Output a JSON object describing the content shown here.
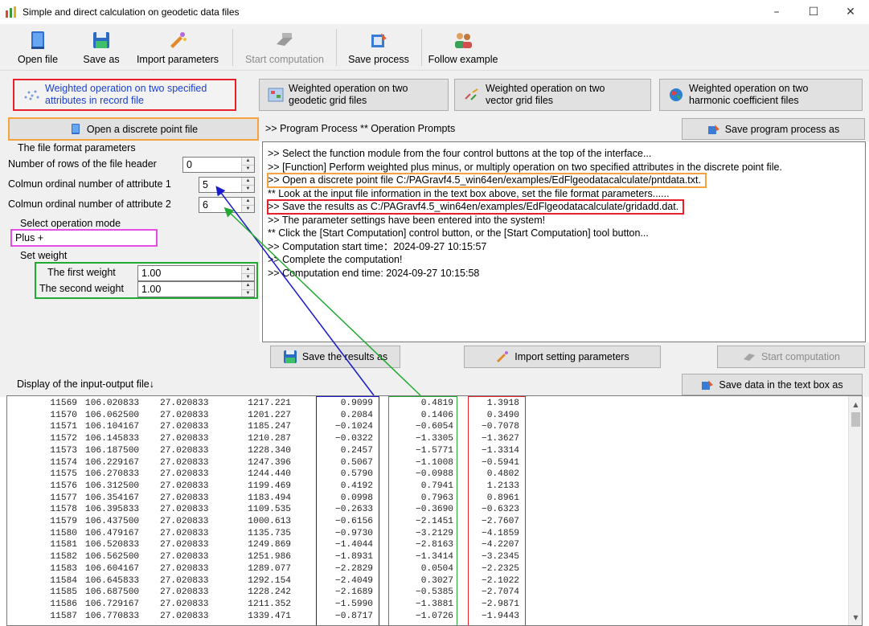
{
  "window": {
    "title": "Simple and direct calculation on geodetic data files",
    "minimize": "–",
    "maximize": "☐",
    "close": "✕"
  },
  "toolbar": {
    "open_file": "Open file",
    "save_as": "Save as",
    "import_parameters": "Import parameters",
    "start_computation": "Start computation",
    "save_process": "Save process",
    "follow_example": "Follow example"
  },
  "modules": {
    "m1_line1": "Weighted operation on two specified",
    "m1_line2": "attributes in record file",
    "m2_line1": "Weighted operation on two",
    "m2_line2": "geodetic grid files",
    "m3_line1": "Weighted operation on two",
    "m3_line2": "vector grid files",
    "m4_line1": "Weighted operation on two",
    "m4_line2": "harmonic coefficient files"
  },
  "left": {
    "open_point_file": "Open a discrete point file",
    "format_params_label": "The file format parameters",
    "header_rows_label": "Number of rows of the file header",
    "header_rows_value": "0",
    "attr1_label": "Colmun ordinal number of attribute 1",
    "attr1_value": "5",
    "attr2_label": "Colmun ordinal number of attribute 2",
    "attr2_value": "6",
    "op_mode_label": "Select operation mode",
    "op_mode_value": "Plus +",
    "set_weight_label": "Set weight",
    "first_weight_label": "The first weight",
    "first_weight_value": "1.00",
    "second_weight_label": "The second weight",
    "second_weight_value": "1.00"
  },
  "process": {
    "header": ">> Program Process  ** Operation Prompts",
    "save_process_btn": "Save program process as",
    "lines": [
      ">> Select the function module from the four control buttons at the top of the interface...",
      ">> [Function] Perform weighted plus minus, or multiply operation on two specified attributes in the discrete point file.",
      ">> Open a discrete point file C:/PAGravf4.5_win64en/examples/EdFlgeodatacalculate/pntdata.txt.",
      "  ** Look at the input file information in the text box above, set the file format parameters......",
      ">> Save the results as C:/PAGravf4.5_win64en/examples/EdFlgeodatacalculate/gridadd.dat.",
      ">> The parameter settings have been entered into the system!",
      "  ** Click the [Start Computation] control button, or the [Start Computation] tool button...",
      ">> Computation start time：2024-09-27 10:15:57",
      ">> Complete the computation!",
      ">> Computation end time: 2024-09-27 10:15:58"
    ]
  },
  "actions": {
    "save_results": "Save the results as",
    "import_settings": "Import setting parameters",
    "start_computation": "Start computation"
  },
  "display": {
    "label": "Display of the input-output file↓",
    "save_text_btn": "Save data in the text box as"
  },
  "data_rows": [
    [
      "11569",
      "106.020833",
      "27.020833",
      "1217.221",
      "0.9099",
      "0.4819",
      "1.3918"
    ],
    [
      "11570",
      "106.062500",
      "27.020833",
      "1201.227",
      "0.2084",
      "0.1406",
      "0.3490"
    ],
    [
      "11571",
      "106.104167",
      "27.020833",
      "1185.247",
      "−0.1024",
      "−0.6054",
      "−0.7078"
    ],
    [
      "11572",
      "106.145833",
      "27.020833",
      "1210.287",
      "−0.0322",
      "−1.3305",
      "−1.3627"
    ],
    [
      "11573",
      "106.187500",
      "27.020833",
      "1228.340",
      "0.2457",
      "−1.5771",
      "−1.3314"
    ],
    [
      "11574",
      "106.229167",
      "27.020833",
      "1247.396",
      "0.5067",
      "−1.1008",
      "−0.5941"
    ],
    [
      "11575",
      "106.270833",
      "27.020833",
      "1244.440",
      "0.5790",
      "−0.0988",
      "0.4802"
    ],
    [
      "11576",
      "106.312500",
      "27.020833",
      "1199.469",
      "0.4192",
      "0.7941",
      "1.2133"
    ],
    [
      "11577",
      "106.354167",
      "27.020833",
      "1183.494",
      "0.0998",
      "0.7963",
      "0.8961"
    ],
    [
      "11578",
      "106.395833",
      "27.020833",
      "1109.535",
      "−0.2633",
      "−0.3690",
      "−0.6323"
    ],
    [
      "11579",
      "106.437500",
      "27.020833",
      "1000.613",
      "−0.6156",
      "−2.1451",
      "−2.7607"
    ],
    [
      "11580",
      "106.479167",
      "27.020833",
      "1135.735",
      "−0.9730",
      "−3.2129",
      "−4.1859"
    ],
    [
      "11581",
      "106.520833",
      "27.020833",
      "1249.869",
      "−1.4044",
      "−2.8163",
      "−4.2207"
    ],
    [
      "11582",
      "106.562500",
      "27.020833",
      "1251.986",
      "−1.8931",
      "−1.3414",
      "−3.2345"
    ],
    [
      "11583",
      "106.604167",
      "27.020833",
      "1289.077",
      "−2.2829",
      "0.0504",
      "−2.2325"
    ],
    [
      "11584",
      "106.645833",
      "27.020833",
      "1292.154",
      "−2.4049",
      "0.3027",
      "−2.1022"
    ],
    [
      "11585",
      "106.687500",
      "27.020833",
      "1228.242",
      "−2.1689",
      "−0.5385",
      "−2.7074"
    ],
    [
      "11586",
      "106.729167",
      "27.020833",
      "1211.352",
      "−1.5990",
      "−1.3881",
      "−2.9871"
    ],
    [
      "11587",
      "106.770833",
      "27.020833",
      "1339.471",
      "−0.8717",
      "−1.0726",
      "−1.9443"
    ]
  ],
  "colors": {
    "red": "#e8202a",
    "orange": "#f4a340",
    "green": "#22aa33",
    "blue": "#1a1acc",
    "magenta": "#e64ce6"
  }
}
